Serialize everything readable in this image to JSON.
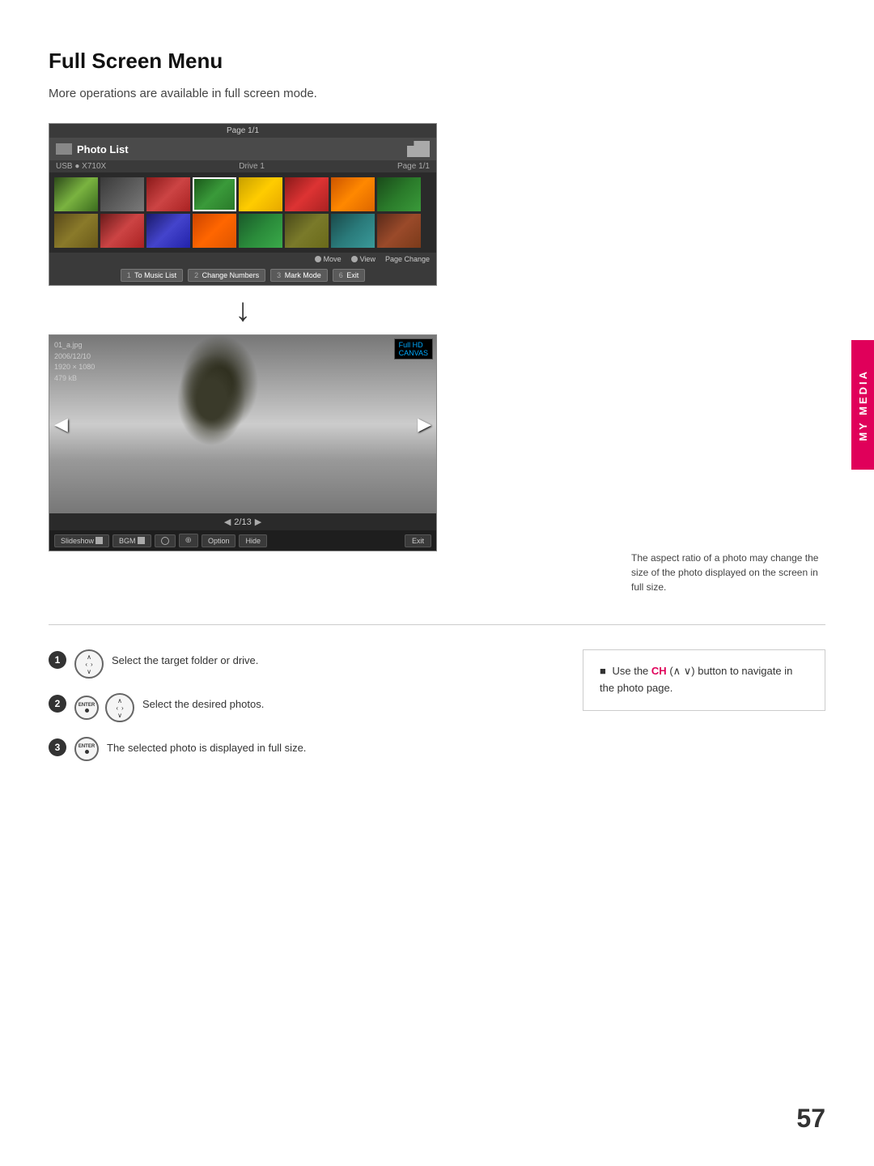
{
  "page": {
    "title": "Full Screen Menu",
    "subtitle": "More operations are available in full screen mode.",
    "page_number": "57"
  },
  "side_tab": {
    "label": "MY MEDIA"
  },
  "top_screen": {
    "page_label": "Page 1/1",
    "header_title": "Photo List",
    "drive_label": "Drive 1",
    "page_info": "Page 1/1",
    "usb_label": "USB ● X710X",
    "nav_move": "Move",
    "nav_view": "View",
    "nav_page_change": "Page Change",
    "btn_music_list": "To Music List",
    "btn_change_numbers": "Change Numbers",
    "btn_mark_mode": "Mark Mode",
    "btn_exit": "Exit"
  },
  "full_screen": {
    "file_name": "01_a.jpg",
    "date": "2006/12/10",
    "resolution": "1920 × 1080",
    "file_size": "479 kB",
    "badge_text": "Full HD",
    "badge_sub": "CANVAS",
    "page_display": "2/13",
    "btn_slideshow": "Slideshow",
    "btn_bgm": "BGM",
    "btn_option": "Option",
    "btn_hide": "Hide",
    "btn_exit": "Exit"
  },
  "side_note": {
    "text": "The aspect ratio of a photo may change the size of the photo displayed on the screen in full size."
  },
  "instructions": {
    "step1": {
      "number": "1",
      "text": "Select the target folder or drive."
    },
    "step2": {
      "number": "2",
      "text": "Select the desired photos."
    },
    "step3": {
      "number": "3",
      "text": "The selected photo is displayed in full size."
    },
    "right_note": {
      "bullet": "■",
      "text": "Use the ",
      "ch_label": "CH",
      "arrow_text": "(∧ ∨)",
      "text2": " button to navigate in the photo page."
    }
  }
}
